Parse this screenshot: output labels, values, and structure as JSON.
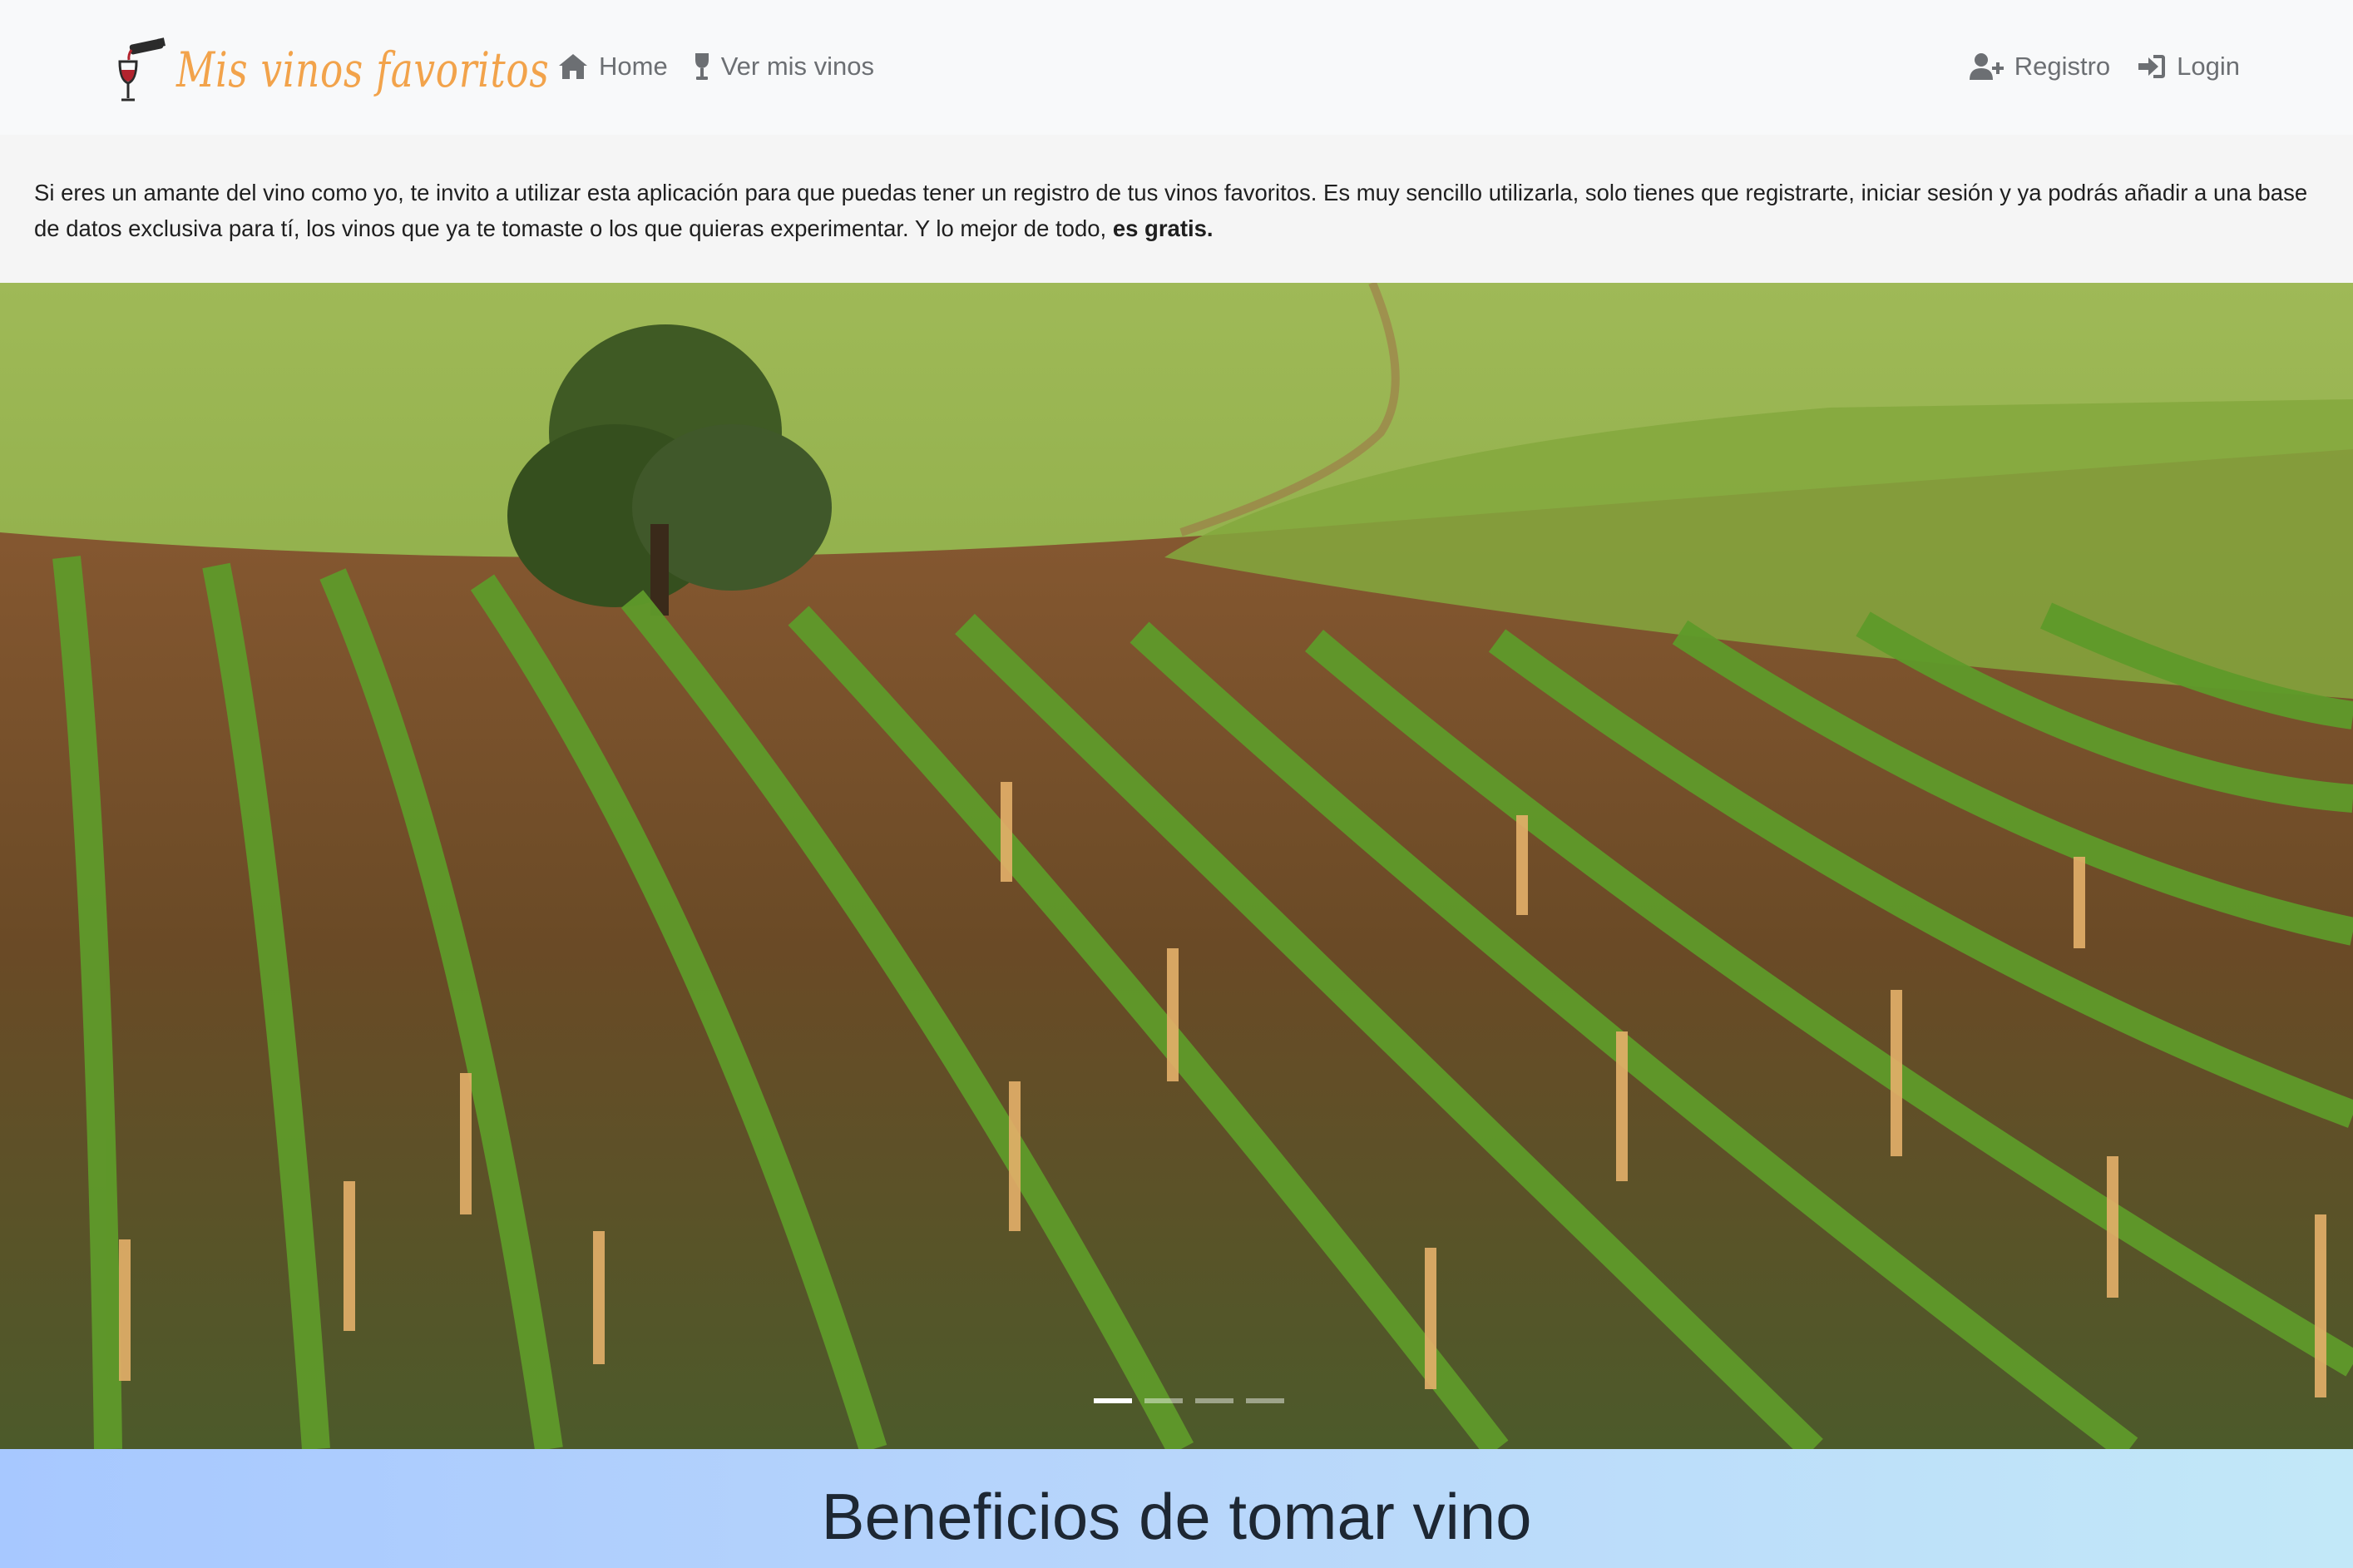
{
  "navbar": {
    "brand": "Mis vinos favoritos",
    "links_left": [
      {
        "label": "Home",
        "icon": "home-icon"
      },
      {
        "label": "Ver mis vinos",
        "icon": "wine-glass-icon"
      }
    ],
    "links_right": [
      {
        "label": "Registro",
        "icon": "user-plus-icon"
      },
      {
        "label": "Login",
        "icon": "sign-in-icon"
      }
    ]
  },
  "intro": {
    "text": "Si eres un amante del vino como yo, te invito a utilizar esta aplicación para que puedas tener un registro de tus vinos favoritos. Es muy sencillo utilizarla, solo tienes que registrarte, iniciar sesión y ya podrás añadir a una base de datos exclusiva para tí, los vinos que ya te tomaste o los que quieras experimentar. Y lo mejor de todo, ",
    "emphasis": "es gratis."
  },
  "carousel": {
    "slides": 4,
    "active_index": 0,
    "image_description": "Vineyard rows on rolling green hills"
  },
  "benefits": {
    "title": "Beneficios de tomar vino"
  },
  "colors": {
    "brand": "#f2a34b",
    "nav_bg": "#f8f9fa",
    "nav_text": "#6c6f73"
  }
}
